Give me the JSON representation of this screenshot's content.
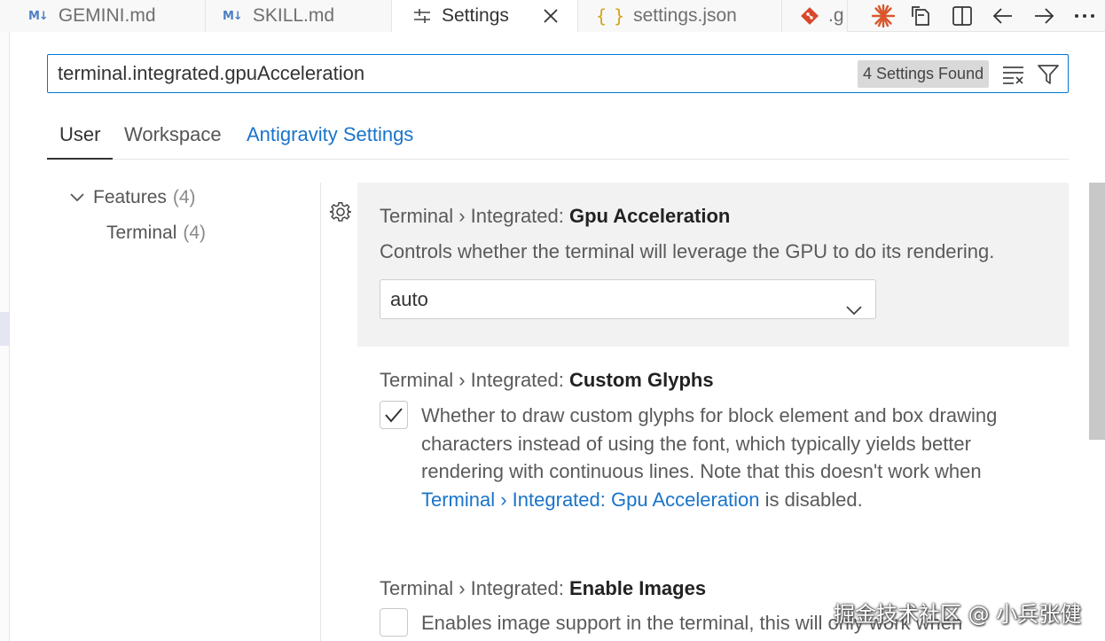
{
  "tabs": [
    {
      "label": "GEMINI.md",
      "icon": "markdown-icon",
      "icon_text": "M↓",
      "active": false
    },
    {
      "label": "SKILL.md",
      "icon": "markdown-icon",
      "icon_text": "M↓",
      "active": false
    },
    {
      "label": "Settings",
      "icon": "settings-sliders-icon",
      "active": true
    },
    {
      "label": "settings.json",
      "icon": "json-braces-icon",
      "icon_text": "{ }",
      "active": false
    },
    {
      "label": ".g",
      "icon": "git-icon",
      "active": false
    }
  ],
  "editor_actions": [
    "asterisk-icon",
    "open-changes-icon",
    "split-editor-icon",
    "go-back-icon",
    "go-forward-icon",
    "more-actions-icon"
  ],
  "search": {
    "value": "terminal.integrated.gpuAcceleration",
    "results_badge": "4 Settings Found"
  },
  "scope_tabs": {
    "user": "User",
    "workspace": "Workspace",
    "antigravity": "Antigravity Settings"
  },
  "tree": {
    "features": {
      "label": "Features",
      "count": "(4)"
    },
    "terminal": {
      "label": "Terminal",
      "count": "(4)"
    }
  },
  "settings": [
    {
      "category": "Terminal › Integrated: ",
      "name": "Gpu Acceleration",
      "description": "Controls whether the terminal will leverage the GPU to do its rendering.",
      "value": "auto"
    },
    {
      "category": "Terminal › Integrated: ",
      "name": "Custom Glyphs",
      "checked": true,
      "description_lines": [
        "Whether to draw custom glyphs for block element and box drawing",
        "characters instead of using the font, which typically yields better",
        "rendering with continuous lines. Note that this doesn't work when"
      ],
      "link": "Terminal › Integrated: Gpu Acceleration",
      "suffix": " is disabled."
    },
    {
      "category": "Terminal › Integrated: ",
      "name": "Enable Images",
      "checked": false,
      "description_lines": [
        "Enables image support in the terminal, this will only work when"
      ]
    }
  ],
  "watermark": "掘金技术社区 @ 小兵张健",
  "colors": {
    "accent": "#0078d4",
    "link": "#1a74c9",
    "focused_row": "#f2f2f2"
  }
}
